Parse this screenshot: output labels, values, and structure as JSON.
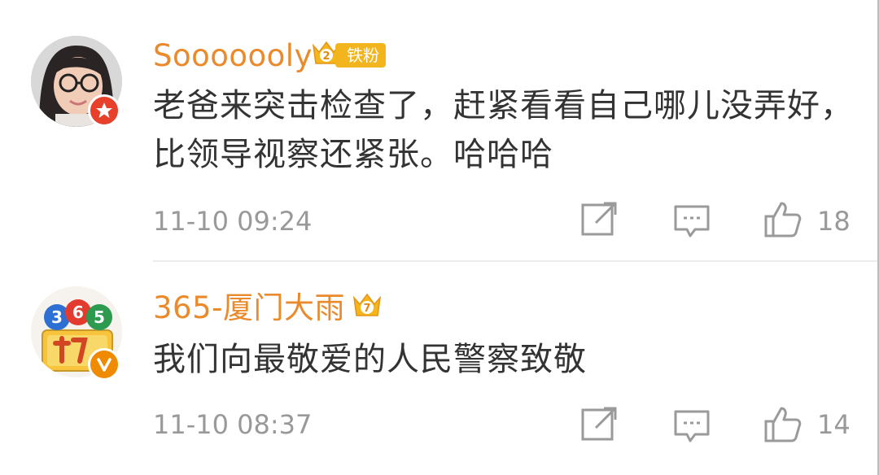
{
  "comments": [
    {
      "username": "Sooooooly",
      "fan_tag": "铁粉",
      "content": "老爸来突击检查了，赶紧看看自己哪儿没弄好，比领导视察还紧张。哈哈哈",
      "time": "11-10 09:24",
      "likes": "18",
      "crown_level": "2"
    },
    {
      "username": "365-厦门大雨",
      "content": "我们向最敬爱的人民警察致敬",
      "time": "11-10 08:37",
      "likes": "14",
      "crown_level": "7"
    }
  ],
  "colors": {
    "username": "#ea8a2b",
    "content": "#333333",
    "meta": "#999999",
    "tag_bg": "#f2b51e"
  },
  "icons": [
    "share-icon",
    "comment-icon",
    "like-icon",
    "crown-icon",
    "verified-icon"
  ]
}
